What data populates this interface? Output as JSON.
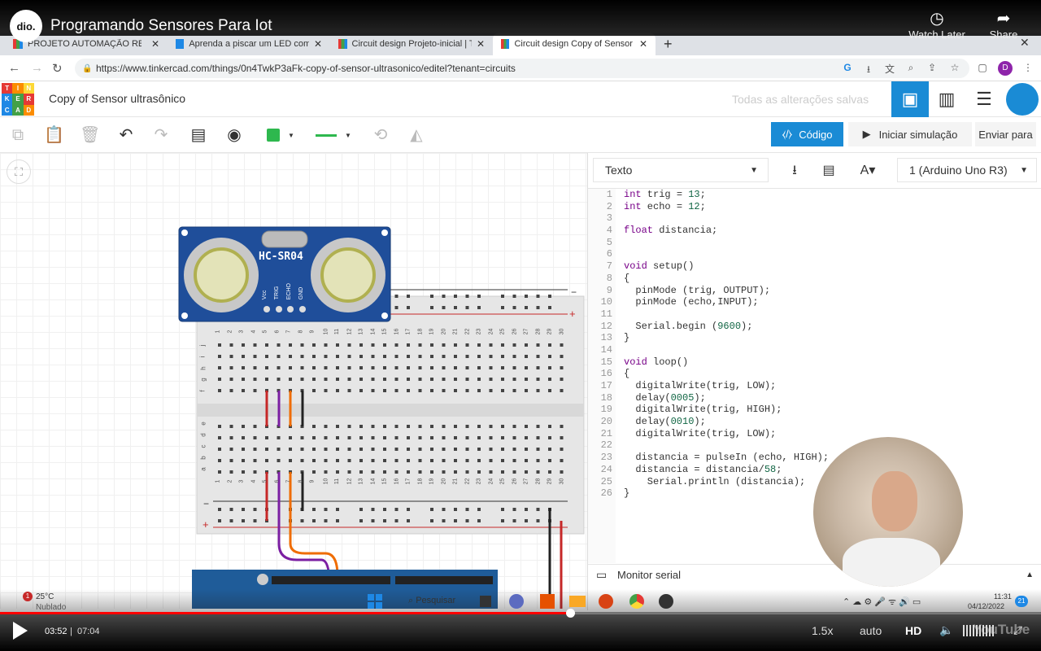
{
  "youtube": {
    "channel_logo": "dio.",
    "title": "Programando Sensores Para Iot",
    "watch_later": "Watch Later",
    "share": "Share",
    "current_time": "03:52",
    "separator": "|",
    "duration": "07:04",
    "speed": "1.5x",
    "quality_auto": "auto",
    "hd": "HD",
    "watermark": "YouTube",
    "progress_fraction": 0.548
  },
  "browser": {
    "tabs": [
      {
        "label": "PROJETO AUTOMAÇÃO RESIDEN..."
      },
      {
        "label": "Aprenda a piscar um LED com Ar..."
      },
      {
        "label": "Circuit design Projeto-inicial | Tin..."
      },
      {
        "label": "Circuit design Copy of Sensor ult..."
      }
    ],
    "new_tab": "+",
    "url": "https://www.tinkercad.com/things/0n4TwkP3aFk-copy-of-sensor-ultrasonico/editel?tenant=circuits",
    "profile_initial": "D"
  },
  "tinkercad": {
    "logo": [
      "T",
      "I",
      "N",
      "K",
      "E",
      "R",
      "C",
      "A",
      "D"
    ],
    "project_title": "Copy of Sensor ultrasônico",
    "saved_status": "Todas as alterações salvas",
    "code_button": "Código",
    "simulate_button": "Iniciar simulação",
    "send_button": "Enviar para",
    "code_mode": "Texto",
    "board": "1 (Arduino Uno R3)",
    "serial_monitor": "Monitor serial",
    "sensor_label": "HC-SR04",
    "sensor_pins": [
      "Vcc",
      "TRIG",
      "ECHO",
      "GND"
    ],
    "breadboard_cols": [
      "1",
      "2",
      "3",
      "4",
      "5",
      "6",
      "7",
      "8",
      "9",
      "10",
      "11",
      "12",
      "13",
      "14",
      "15",
      "16",
      "17",
      "18",
      "19",
      "20",
      "21",
      "22",
      "23",
      "24",
      "25",
      "26",
      "27",
      "28",
      "29",
      "30"
    ],
    "breadboard_rows_top": [
      "j",
      "i",
      "h",
      "g",
      "f"
    ],
    "breadboard_rows_bottom": [
      "e",
      "d",
      "c",
      "b",
      "a"
    ],
    "rail_minus": "−",
    "rail_plus": "+"
  },
  "code_lines": [
    "int trig = 13;",
    "int echo = 12;",
    "",
    "float distancia;",
    "",
    "",
    "void setup()",
    "{",
    "  pinMode (trig, OUTPUT);",
    "  pinMode (echo,INPUT);",
    "",
    "  Serial.begin (9600);",
    "}",
    "",
    "void loop()",
    "{",
    "  digitalWrite(trig, LOW);",
    "  delay(0005);",
    "  digitalWrite(trig, HIGH);",
    "  delay(0010);",
    "  digitalWrite(trig, LOW);",
    "",
    "  distancia = pulseIn (echo, HIGH);",
    "  distancia = distancia/58;",
    "    Serial.println (distancia);",
    "}"
  ],
  "taskbar": {
    "weather_temp": "25°C",
    "weather_desc": "Nublado",
    "weather_badge": "1",
    "search": "Pesquisar",
    "time": "11:31",
    "date": "04/12/2022",
    "notif_count": "21"
  },
  "colors": {
    "accent": "#1a8bd5",
    "progress": "#ff0000",
    "pcb": "#1f4e9a"
  }
}
